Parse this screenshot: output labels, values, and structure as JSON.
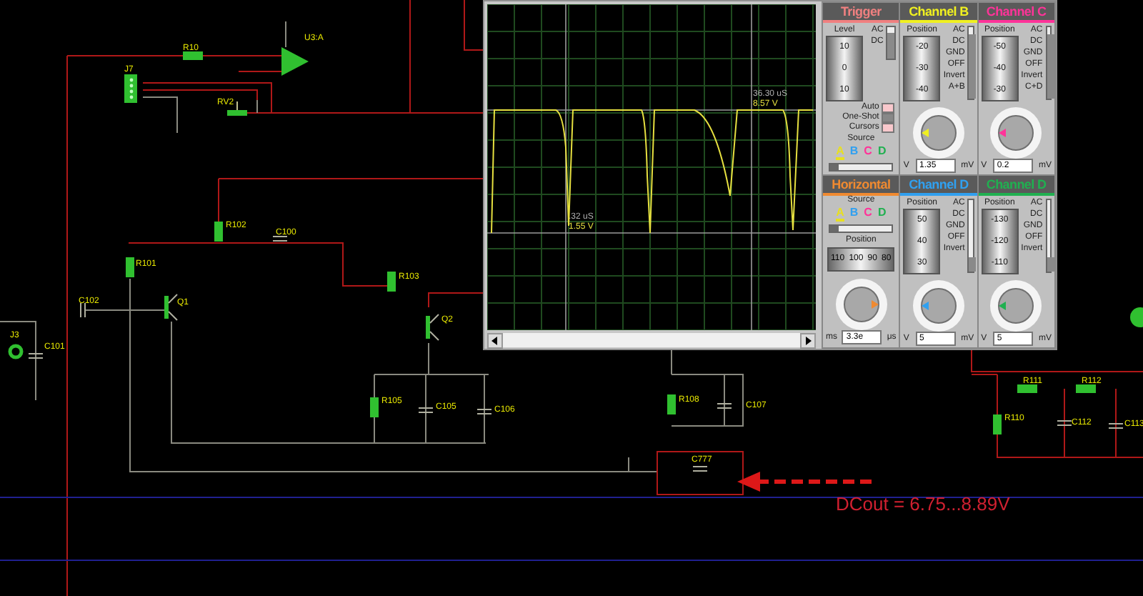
{
  "schematic": {
    "components": [
      {
        "label": "R10",
        "kind": "resistor"
      },
      {
        "label": "U3:A",
        "kind": "opamp"
      },
      {
        "label": "J7",
        "kind": "connector"
      },
      {
        "label": "RV2",
        "kind": "potentiometer"
      },
      {
        "label": "R102",
        "kind": "resistor"
      },
      {
        "label": "C100",
        "kind": "capacitor"
      },
      {
        "label": "R101",
        "kind": "resistor"
      },
      {
        "label": "C102",
        "kind": "capacitor"
      },
      {
        "label": "Q1",
        "kind": "transistor"
      },
      {
        "label": "R103",
        "kind": "resistor"
      },
      {
        "label": "Q2",
        "kind": "transistor"
      },
      {
        "label": "J3",
        "kind": "jack"
      },
      {
        "label": "C101",
        "kind": "capacitor"
      },
      {
        "label": "R105",
        "kind": "resistor"
      },
      {
        "label": "C105",
        "kind": "capacitor"
      },
      {
        "label": "C106",
        "kind": "capacitor"
      },
      {
        "label": "R108",
        "kind": "resistor"
      },
      {
        "label": "C107",
        "kind": "capacitor"
      },
      {
        "label": "C777",
        "kind": "capacitor"
      },
      {
        "label": "R111",
        "kind": "resistor"
      },
      {
        "label": "R112",
        "kind": "resistor"
      },
      {
        "label": "R110",
        "kind": "resistor"
      },
      {
        "label": "C112",
        "kind": "capacitor"
      },
      {
        "label": "C113",
        "kind": "capacitor"
      }
    ],
    "annotation": "DCout = 6.75...8.89V"
  },
  "scope": {
    "cursor_readouts": [
      {
        "time": "36.30 uS",
        "voltage": "8.57 V"
      },
      {
        "time": ".32 uS",
        "voltage": "1.55 V"
      }
    ],
    "panels": [
      {
        "kind": "trigger",
        "title": "Trigger",
        "color": "#f08080",
        "level_label": "Level",
        "scale": [
          "10",
          "0",
          "10"
        ],
        "coupling": [
          "AC",
          "DC"
        ],
        "coupling_switch": {
          "level": 0.8
        },
        "modes": [
          {
            "label": "Auto",
            "on": true
          },
          {
            "label": "One-Shot",
            "on": false
          },
          {
            "label": "Cursors",
            "on": true
          }
        ],
        "source_label": "Source",
        "sources": [
          {
            "label": "A",
            "color": "#e8e020",
            "selected": true
          },
          {
            "label": "B",
            "color": "#30a0f0",
            "selected": false
          },
          {
            "label": "C",
            "color": "#ff3399",
            "selected": false
          },
          {
            "label": "D",
            "color": "#20b050",
            "selected": false
          }
        ],
        "source_slider": {
          "level": 0.15
        }
      },
      {
        "kind": "channel",
        "title": "Channel B",
        "color": "#f0f020",
        "position_label": "Position",
        "scale": [
          "-20",
          "-30",
          "-40"
        ],
        "coupling": [
          "AC",
          "DC",
          "GND",
          "OFF"
        ],
        "coupling_switch": {
          "level": 0.9
        },
        "invert": "Invert",
        "combine": "A+B",
        "units": [
          "V",
          "mV"
        ],
        "readout": "1.35"
      },
      {
        "kind": "channel",
        "title": "Channel C",
        "color": "#ff3399",
        "position_label": "Position",
        "scale": [
          "-50",
          "-40",
          "-30"
        ],
        "coupling": [
          "AC",
          "DC",
          "GND",
          "OFF"
        ],
        "coupling_switch": {
          "level": 0.9
        },
        "invert": "Invert",
        "combine": "C+D",
        "units": [
          "V",
          "mV"
        ],
        "readout": "0.2"
      },
      {
        "kind": "horizontal",
        "title": "Horizontal",
        "color": "#f08a30",
        "source_label": "Source",
        "sources": [
          {
            "label": "A",
            "color": "#e8e020",
            "selected": true
          },
          {
            "label": "B",
            "color": "#30a0f0",
            "selected": false
          },
          {
            "label": "C",
            "color": "#ff3399",
            "selected": false
          },
          {
            "label": "D",
            "color": "#20b050",
            "selected": false
          }
        ],
        "source_slider": {
          "level": 0.15
        },
        "position_label": "Position",
        "scale": [
          "110",
          "100",
          "90",
          "80"
        ],
        "units": [
          "ms",
          "μs"
        ],
        "readout": "3.3e"
      },
      {
        "kind": "channel",
        "title": "Channel D",
        "color": "#30a0f0",
        "position_label": "Position",
        "scale": [
          "50",
          "40",
          "30"
        ],
        "coupling": [
          "AC",
          "DC",
          "GND",
          "OFF"
        ],
        "coupling_switch": {
          "level": 0.2
        },
        "invert": "Invert",
        "units": [
          "V",
          "mV"
        ],
        "readout": "5"
      },
      {
        "kind": "channel",
        "title": "Channel D",
        "color": "#20b050",
        "position_label": "Position",
        "scale": [
          "-130",
          "-120",
          "-110"
        ],
        "coupling": [
          "AC",
          "DC",
          "GND",
          "OFF"
        ],
        "coupling_switch": {
          "level": 0.2
        },
        "invert": "Invert",
        "units": [
          "V",
          "mV"
        ],
        "readout": "5"
      }
    ]
  }
}
